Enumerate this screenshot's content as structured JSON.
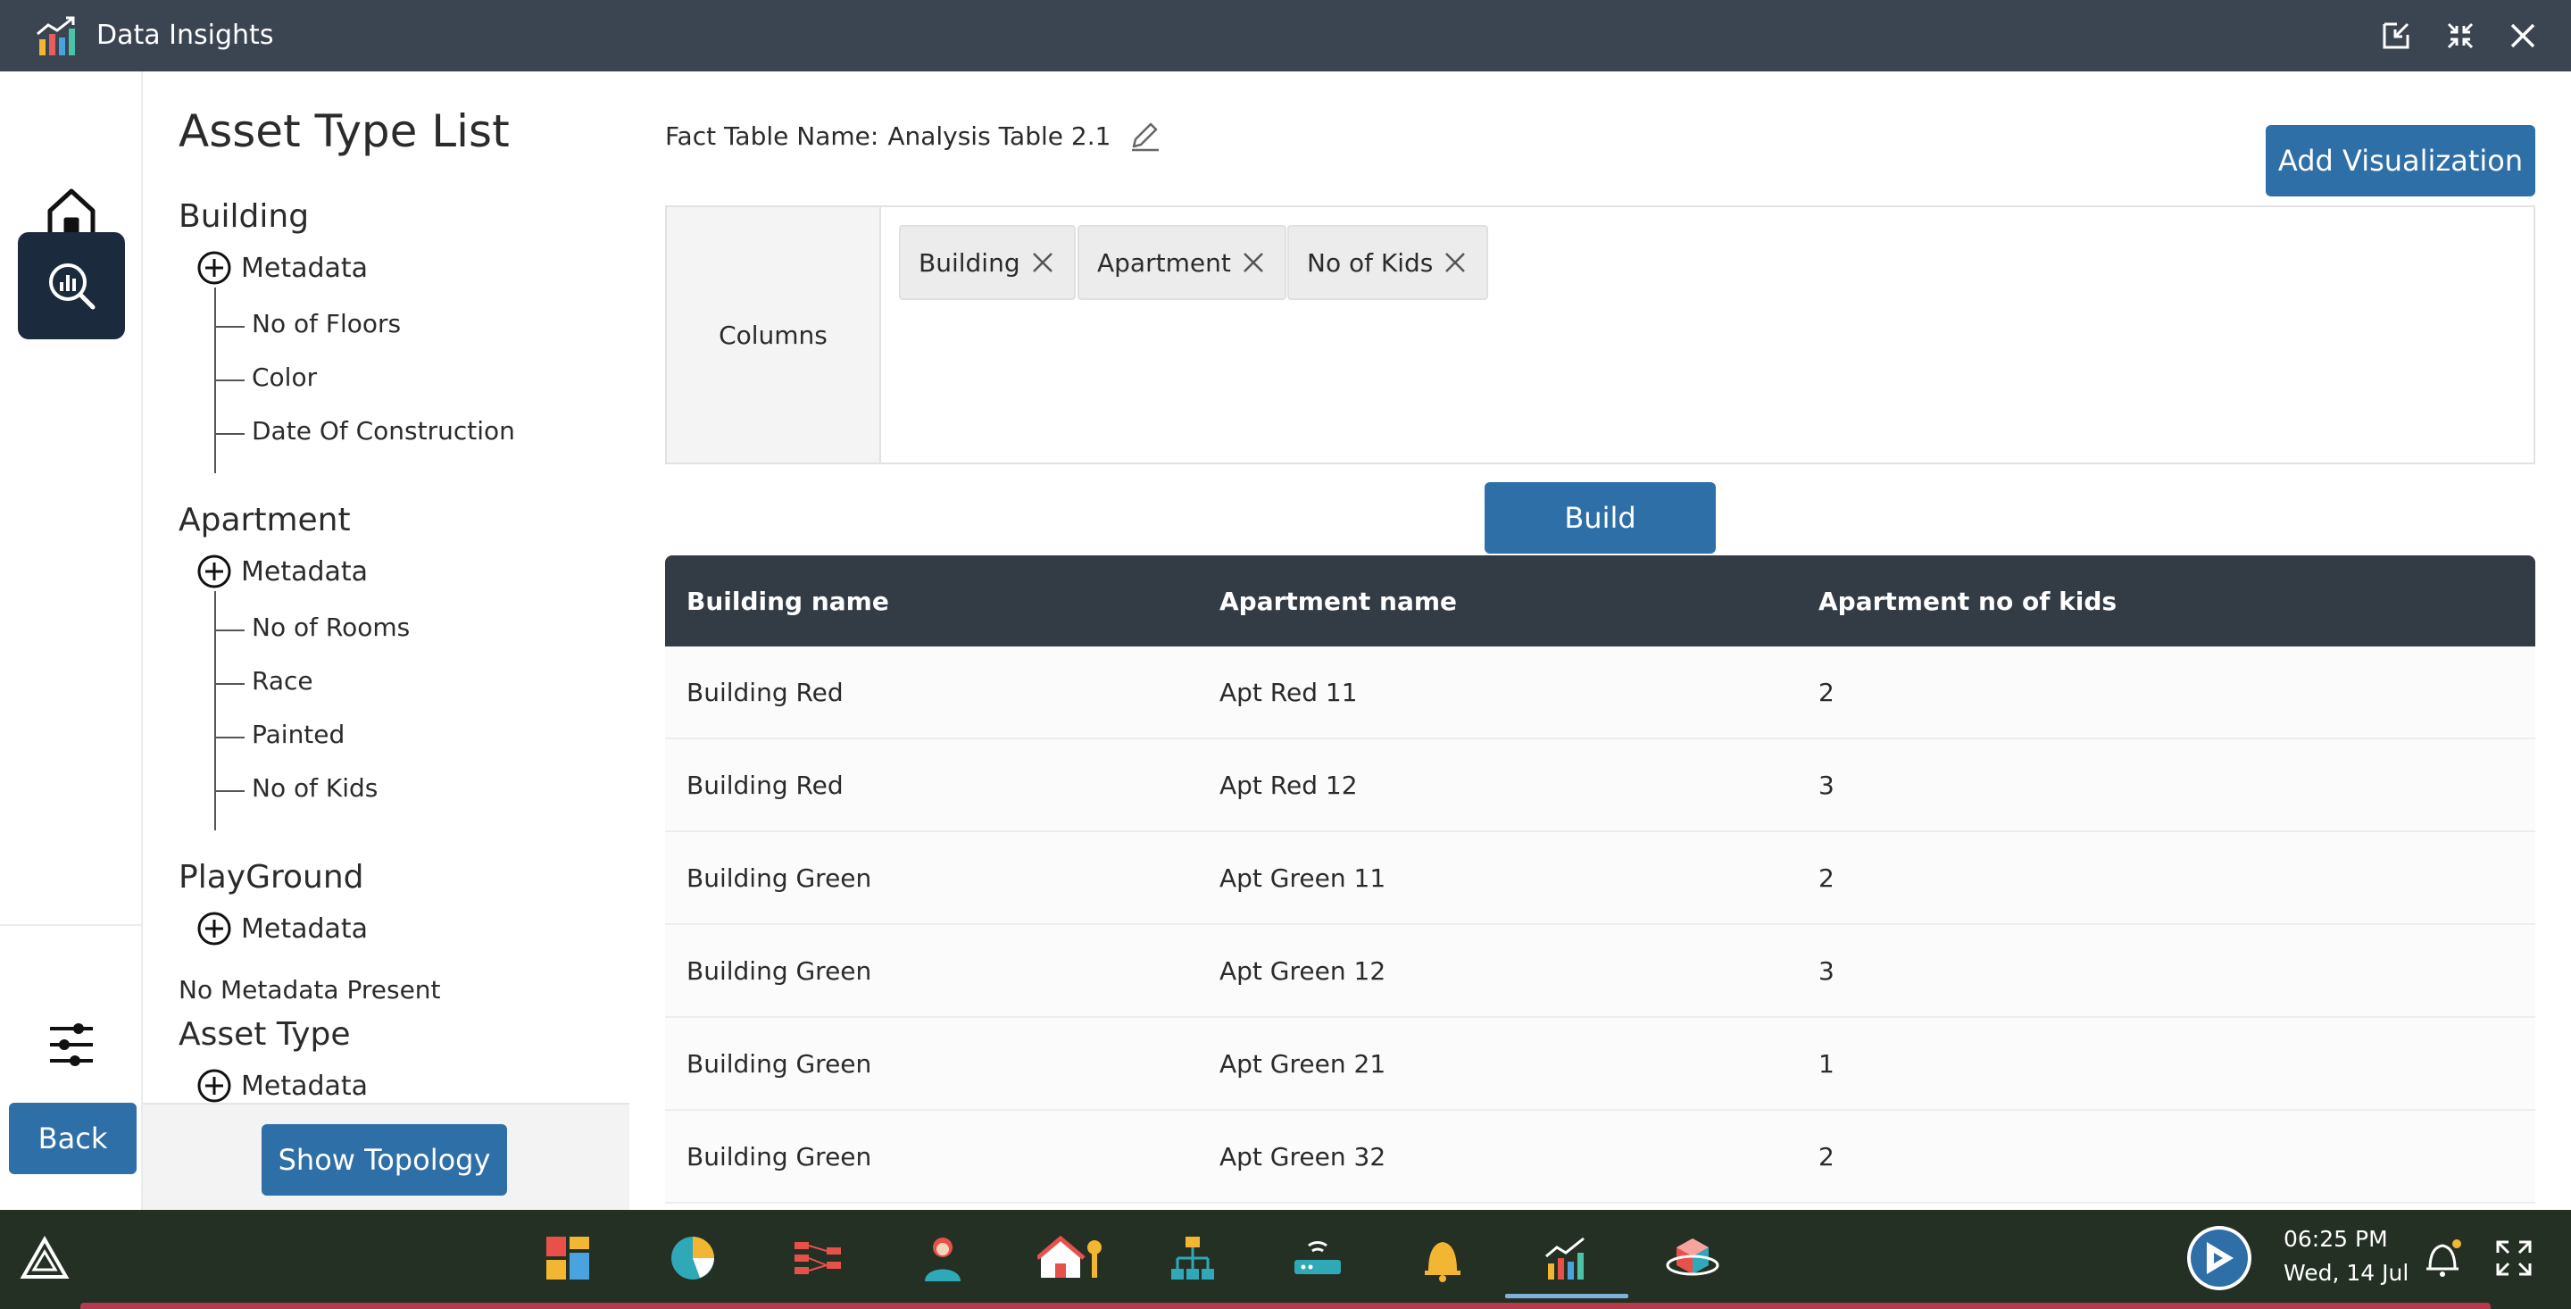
{
  "window": {
    "title": "Data Insights"
  },
  "rail": {
    "back_label": "Back"
  },
  "asset_panel": {
    "title": "Asset Type List",
    "metadata_label": "Metadata",
    "groups": [
      {
        "name": "Building",
        "items": [
          "No of Floors",
          "Color",
          "Date Of Construction"
        ]
      },
      {
        "name": "Apartment",
        "items": [
          "No of Rooms",
          "Race",
          "Painted",
          "No of Kids"
        ]
      },
      {
        "name": "PlayGround",
        "items": [],
        "empty_text": "No Metadata Present"
      },
      {
        "name": "Asset Type",
        "items": []
      }
    ],
    "show_topology_label": "Show Topology"
  },
  "main": {
    "fact_table_label": "Fact Table Name:",
    "fact_table_name": "Analysis Table 2.1",
    "add_visualization_label": "Add Visualization",
    "columns_label": "Columns",
    "chips": [
      "Building",
      "Apartment",
      "No of Kids"
    ],
    "build_label": "Build"
  },
  "table": {
    "headers": [
      "Building name",
      "Apartment name",
      "Apartment no of kids"
    ],
    "rows": [
      [
        "Building Red",
        "Apt Red 11",
        "2"
      ],
      [
        "Building Red",
        "Apt Red 12",
        "3"
      ],
      [
        "Building Green",
        "Apt Green 11",
        "2"
      ],
      [
        "Building Green",
        "Apt Green 12",
        "3"
      ],
      [
        "Building Green",
        "Apt Green 21",
        "1"
      ],
      [
        "Building Green",
        "Apt Green 32",
        "2"
      ]
    ]
  },
  "taskbar": {
    "time": "06:25 PM",
    "date": "Wed, 14 Jul"
  },
  "colors": {
    "primary_button": "#2f6fa8",
    "title_bar": "#3b4552",
    "table_header": "#333b45",
    "active_rail": "#1c2a3e"
  }
}
